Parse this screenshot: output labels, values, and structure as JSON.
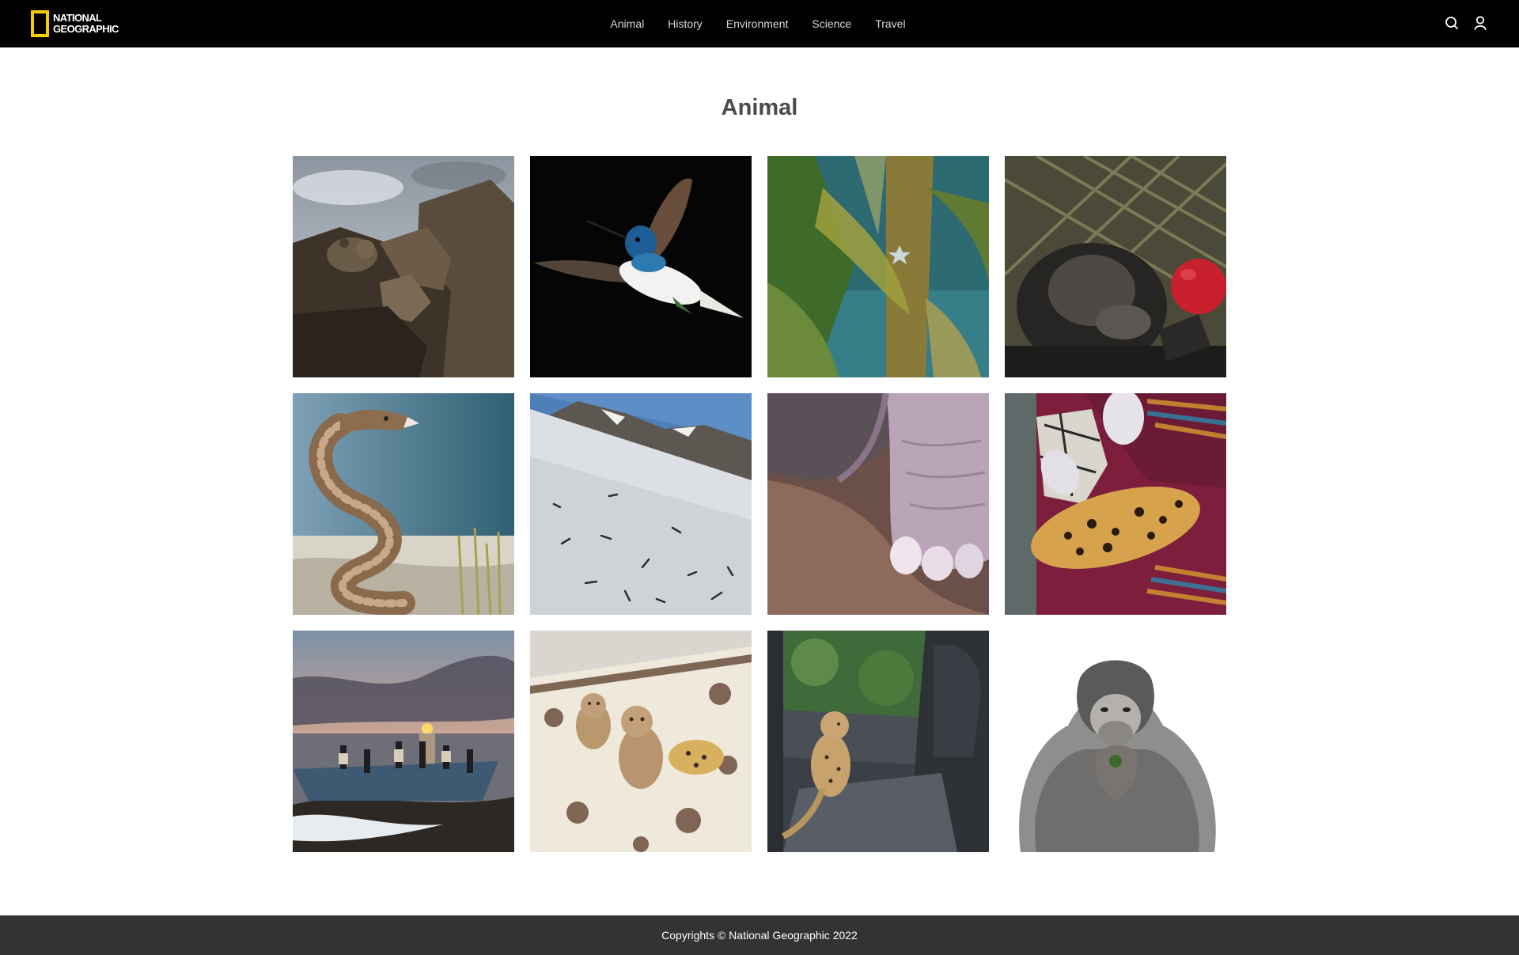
{
  "header": {
    "logo_line1": "NATIONAL",
    "logo_line2": "GEOGRAPHIC",
    "nav": [
      "Animal",
      "History",
      "Environment",
      "Science",
      "Travel"
    ],
    "icons": [
      "search-icon",
      "user-icon"
    ],
    "accent_color": "#f8cd00"
  },
  "main": {
    "title": "Animal",
    "photos": [
      {
        "subject": "pika-on-rocks"
      },
      {
        "subject": "hummingbird"
      },
      {
        "subject": "kelp-with-starfish"
      },
      {
        "subject": "chimpanzee-with-red-ball"
      },
      {
        "subject": "rattlesnake"
      },
      {
        "subject": "worms-on-snow-slope"
      },
      {
        "subject": "elephant-foot"
      },
      {
        "subject": "leopard-vet-care"
      },
      {
        "subject": "boat-at-sunset"
      },
      {
        "subject": "cheetah-cubs-on-rug"
      },
      {
        "subject": "cheetah-cub-in-car"
      },
      {
        "subject": "bonobo-portrait"
      }
    ]
  },
  "footer": {
    "text": "Copyrights © National Geographic 2022"
  }
}
